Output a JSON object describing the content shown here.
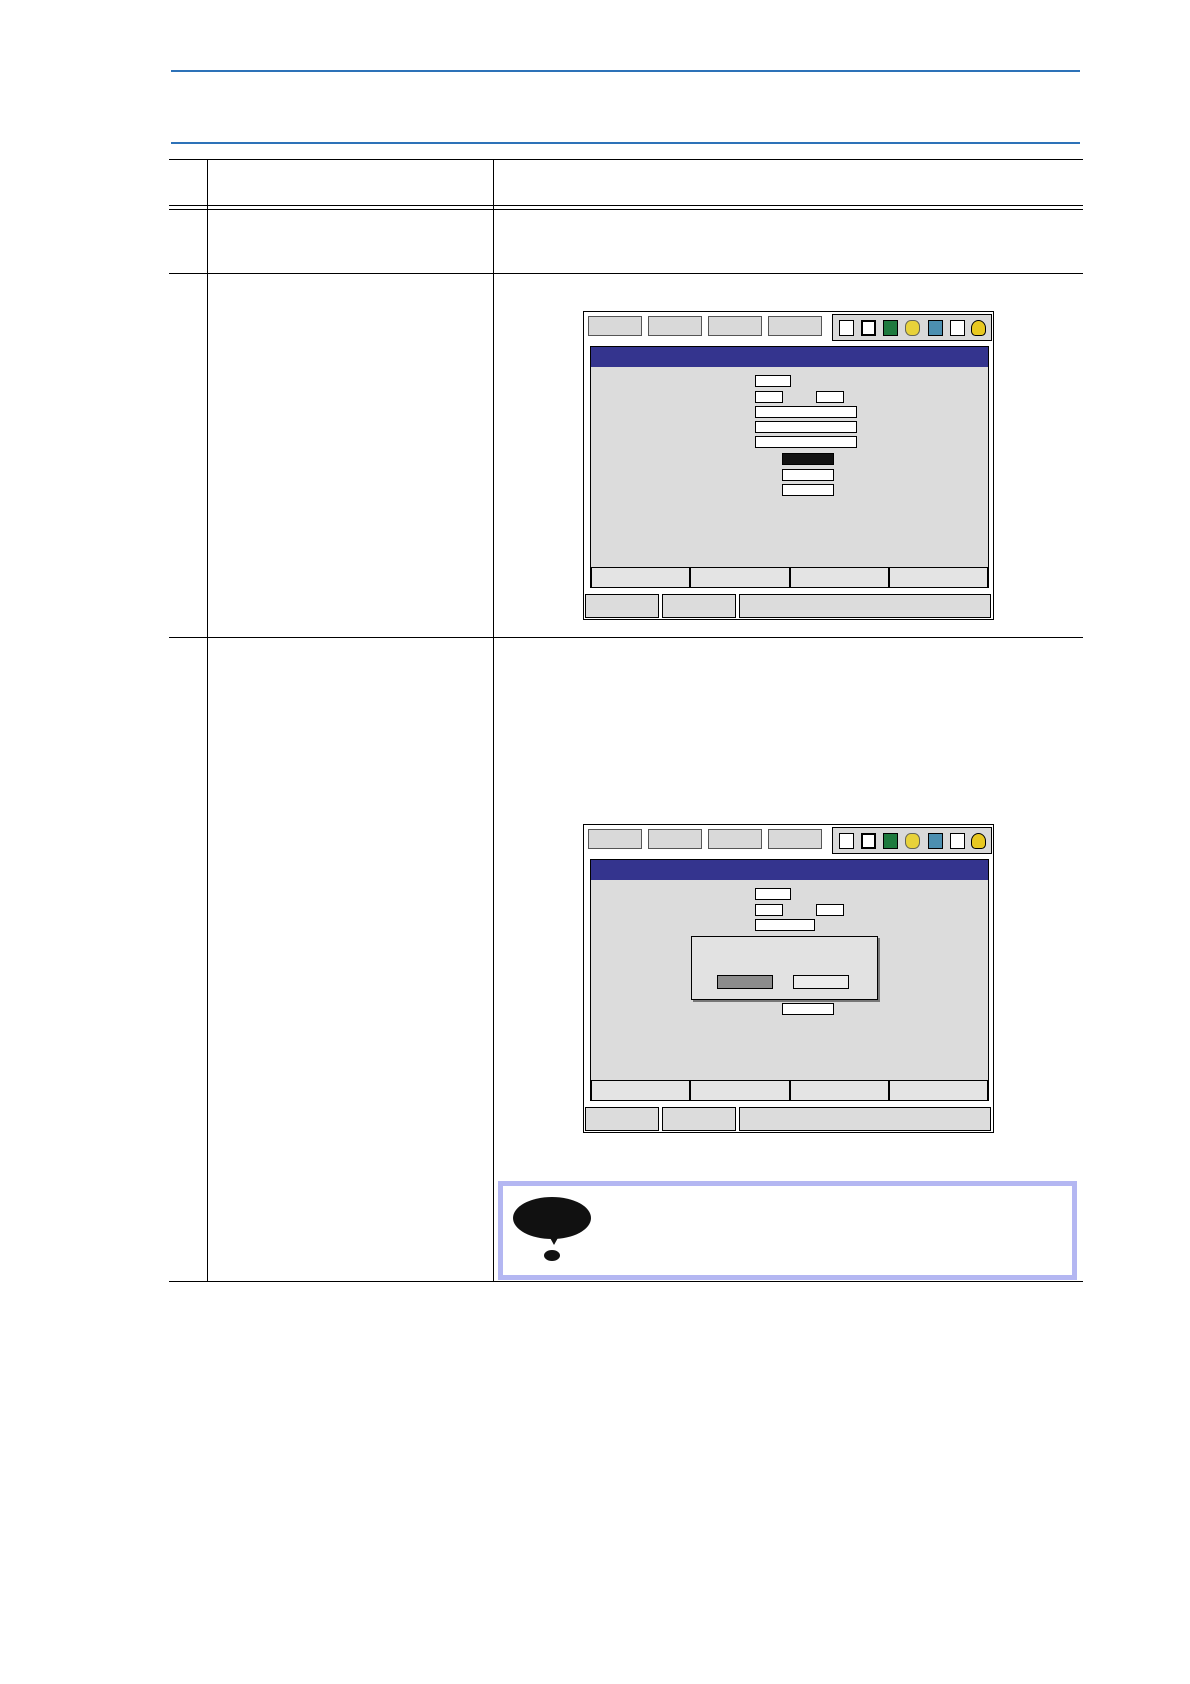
{
  "document": {
    "header_text": "",
    "table_columns": [
      "",
      "",
      ""
    ],
    "rows": [
      {
        "step": "",
        "operation": "",
        "explanation": ""
      },
      {
        "step": "",
        "operation": "",
        "explanation": ""
      },
      {
        "step": "",
        "operation": "",
        "explanation": ""
      }
    ],
    "note_text": ""
  },
  "pendant_screens": [
    {
      "dialog": false
    },
    {
      "dialog": true
    }
  ],
  "colors": {
    "accent_rule": "#2d72b8",
    "title_bar": "#34348e",
    "note_border": "#b4b7f2"
  },
  "icons": [
    "arrows-icon",
    "sigma-icon",
    "chart-icon",
    "tool-icon",
    "controller-icon",
    "exit-icon",
    "hand-icon"
  ]
}
